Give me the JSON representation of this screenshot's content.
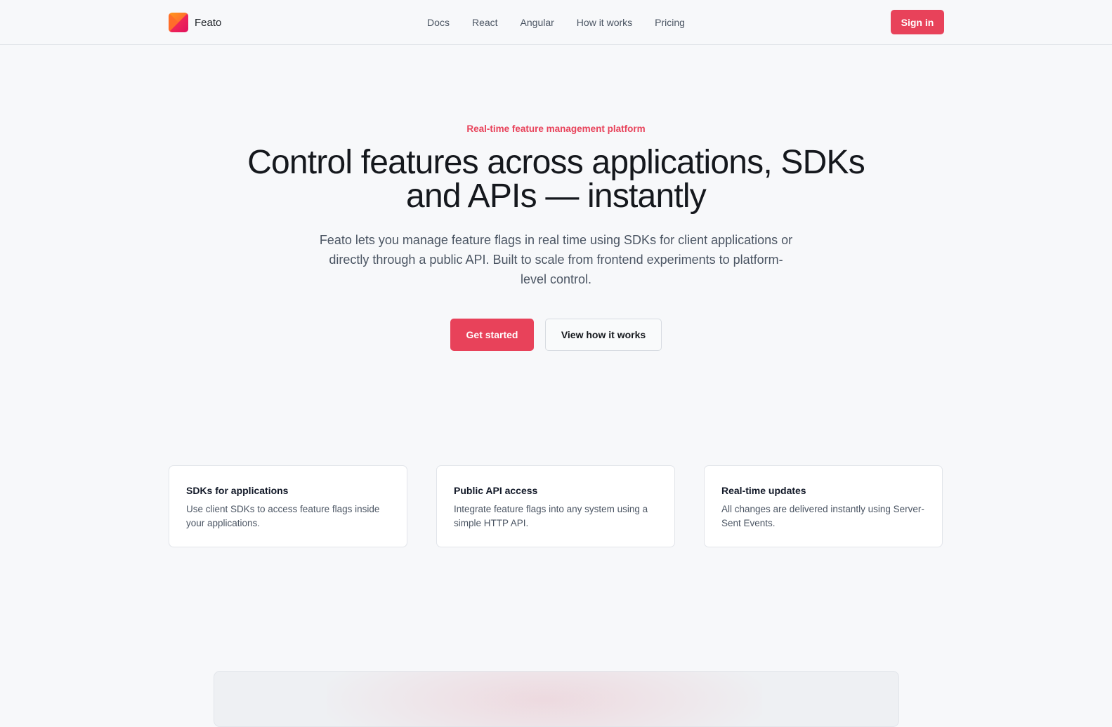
{
  "brand": {
    "name": "Feato",
    "logo_icon": "feato-logo-icon",
    "colors": [
      "#ff8a00",
      "#ff2d55",
      "#e0115f"
    ]
  },
  "nav": {
    "items": [
      {
        "label": "Docs"
      },
      {
        "label": "React"
      },
      {
        "label": "Angular"
      },
      {
        "label": "How it works"
      },
      {
        "label": "Pricing"
      }
    ],
    "signin_label": "Sign in"
  },
  "hero": {
    "eyebrow": "Real-time feature management platform",
    "headline": "Control features across applications, SDKs and APIs — instantly",
    "description": "Feato lets you manage feature flags in real time using SDKs for client applications or directly through a public API. Built to scale from frontend experiments to platform-level control.",
    "primary_cta": "Get started",
    "secondary_cta": "View how it works"
  },
  "features": [
    {
      "title": "SDKs for applications",
      "text": "Use client SDKs to access feature flags inside your applications."
    },
    {
      "title": "Public API access",
      "text": "Integrate feature flags into any system using a simple HTTP API."
    },
    {
      "title": "Real-time updates",
      "text": "All changes are delivered instantly using Server-Sent Events."
    }
  ],
  "theme": {
    "accent": "#e8425a",
    "background": "#f7f8fa",
    "text": "#15181d",
    "muted_text": "#4b5563"
  }
}
